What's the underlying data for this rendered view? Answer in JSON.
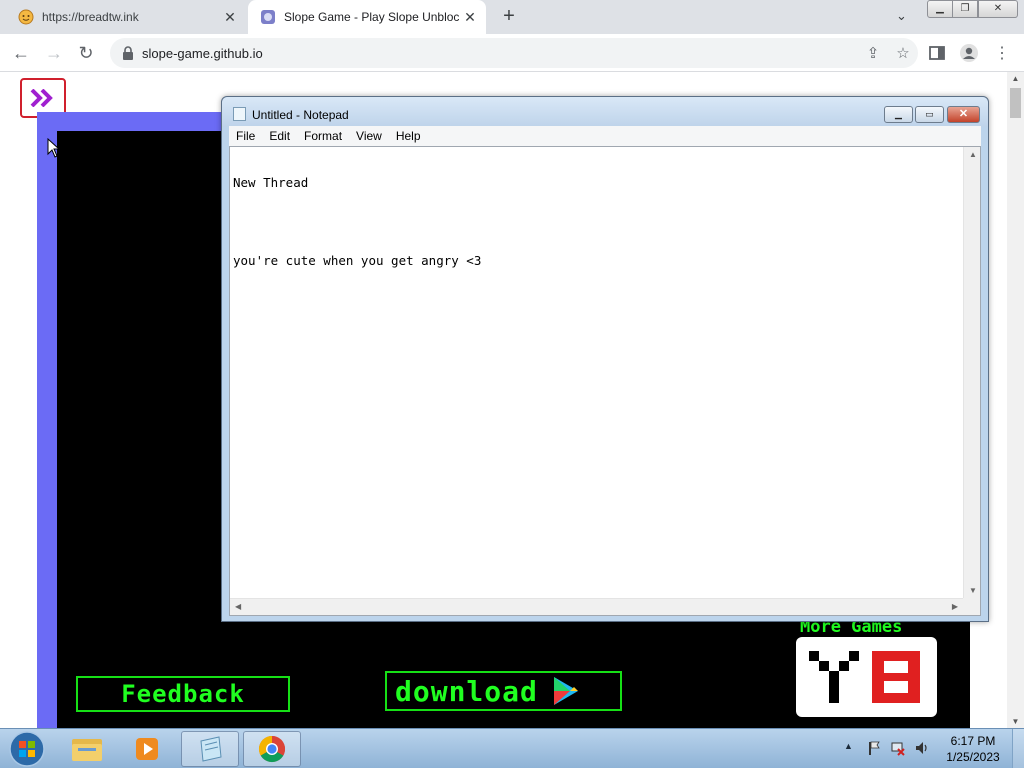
{
  "browser": {
    "tabs": [
      {
        "title": "https://breadtw.ink",
        "active": false,
        "favicon": "emoji-face-icon"
      },
      {
        "title": "Slope Game - Play Slope Unblocked",
        "active": true,
        "favicon": "slope-game-icon"
      }
    ],
    "new_tab_label": "+",
    "address": "slope-game.github.io"
  },
  "game_page": {
    "feedback_label": "Feedback",
    "download_label": "download",
    "more_games_label": "More Games",
    "brand_colors": {
      "frame": "#6b6bf5",
      "neon": "#20ff20",
      "logo_red": "#e02020"
    }
  },
  "notepad": {
    "title": "Untitled - Notepad",
    "menu": [
      "File",
      "Edit",
      "Format",
      "View",
      "Help"
    ],
    "lines": [
      "New Thread",
      "",
      "you're cute when you get angry <3"
    ]
  },
  "taskbar": {
    "apps": [
      "windows-explorer",
      "media-player",
      "notepad",
      "chrome"
    ],
    "time": "6:17 PM",
    "date": "1/25/2023"
  }
}
